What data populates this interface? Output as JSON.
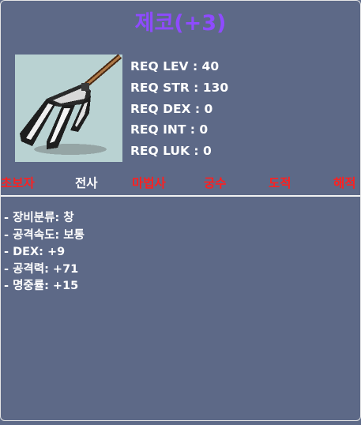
{
  "item": {
    "name": "제코(+3)",
    "name_color": "#8e4bff",
    "icon": "trident-spear-icon"
  },
  "requirements": [
    {
      "text": "REQ LEV : 40"
    },
    {
      "text": "REQ STR : 130"
    },
    {
      "text": "REQ DEX : 0"
    },
    {
      "text": "REQ INT : 0"
    },
    {
      "text": "REQ LUK : 0"
    }
  ],
  "jobs": [
    {
      "label": "초보자",
      "color": "#ff2020",
      "allowed": false
    },
    {
      "label": "전사",
      "color": "#ffffff",
      "allowed": true
    },
    {
      "label": "마법사",
      "color": "#ff2020",
      "allowed": false
    },
    {
      "label": "궁수",
      "color": "#ff2020",
      "allowed": false
    },
    {
      "label": "도적",
      "color": "#ff2020",
      "allowed": false
    },
    {
      "label": "해적",
      "color": "#ff2020",
      "allowed": false
    }
  ],
  "stats": [
    {
      "text": "- 장비분류: 창"
    },
    {
      "text": "- 공격속도: 보통"
    },
    {
      "text": "- DEX: +9"
    },
    {
      "text": "- 공격력: +71"
    },
    {
      "text": "- 명중률: +15"
    }
  ]
}
